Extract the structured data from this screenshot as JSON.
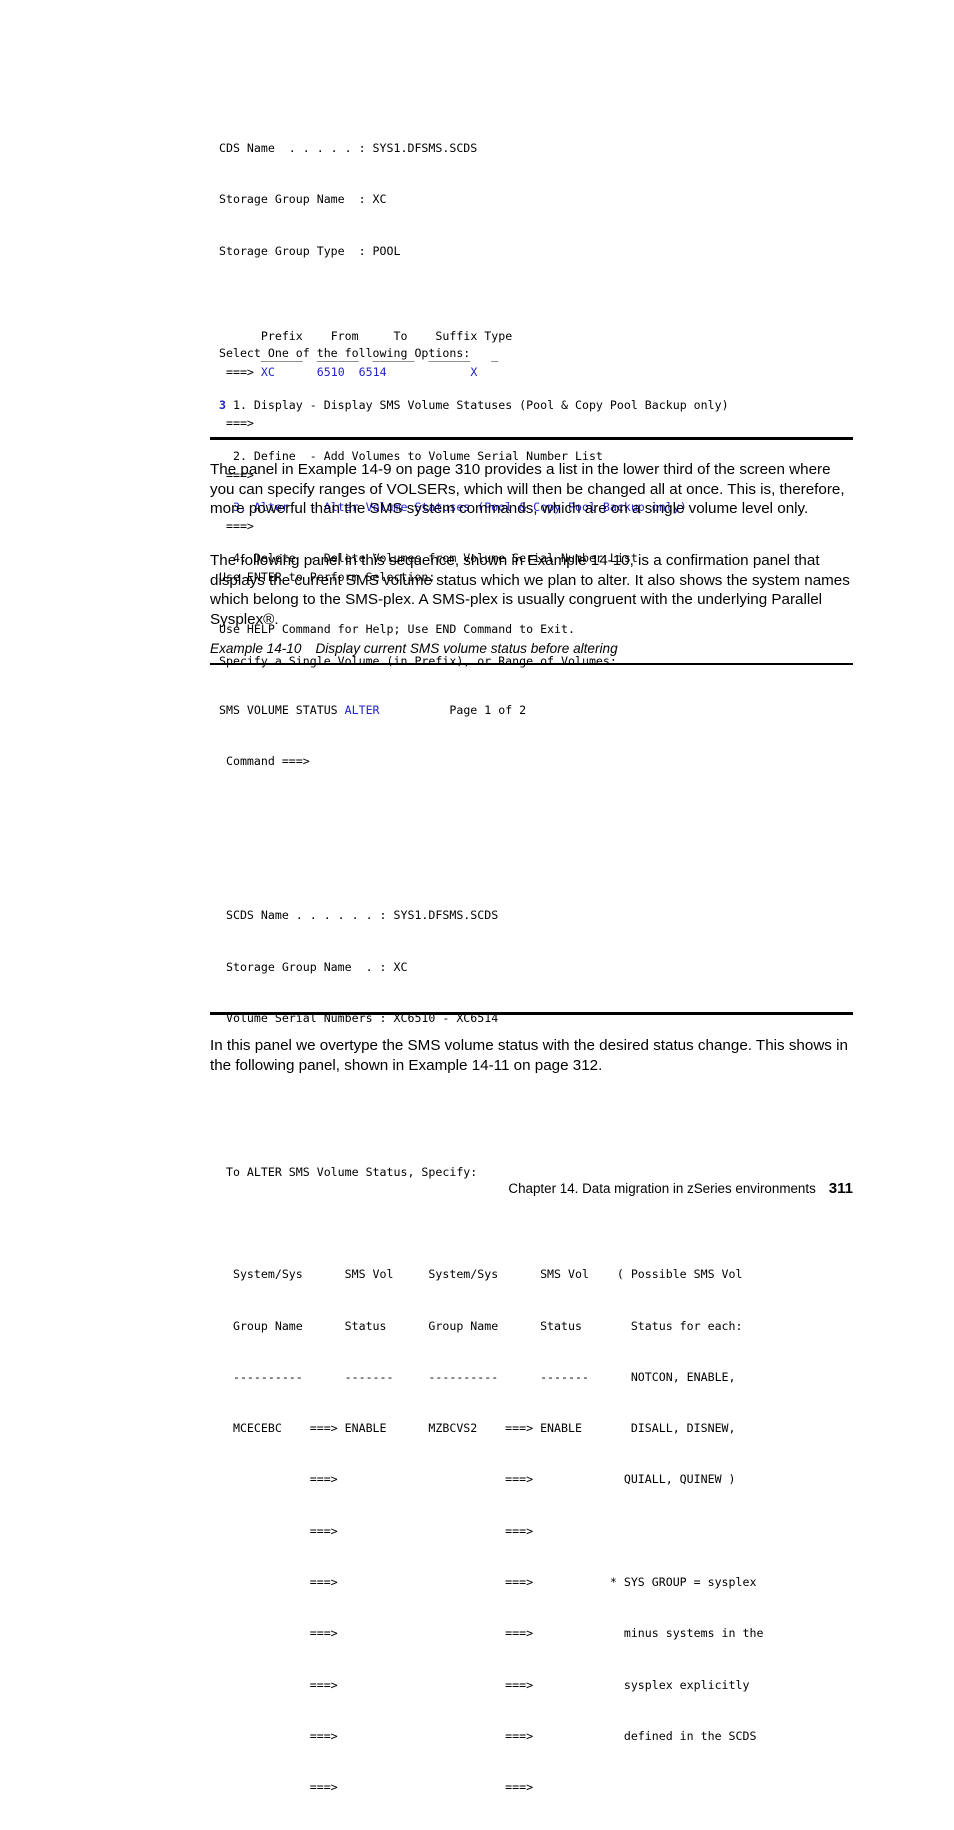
{
  "document": {
    "footer": {
      "chapter_text": "Chapter 14. Data migration in zSeries environments",
      "page_number": "311"
    }
  },
  "panel_1": {
    "name": "sms-volume-status-alter-selection-panel",
    "lines": {
      "cds_name": "CDS Name  . . . . . : SYS1.DFSMS.SCDS",
      "storage_group_name": "Storage Group Name  : XC",
      "storage_group_type": "Storage Group Type  : POOL",
      "select_prompt": "Select One of the following Options:",
      "selection_value": "3",
      "option_1": "1. Display - Display SMS Volume Statuses (Pool & Copy Pool Backup only)",
      "option_2": "2. Define  - Add Volumes to Volume Serial Number List",
      "option_3": "3. Alter   - Alter Volume Statuses (Pool & Copy Pool Backup only)",
      "option_4": "4. Delete  - Delete Volumes from Volume Serial Number List",
      "specify_prompt": "Specify a Single Volume (in Prefix), or Range of Volumes:",
      "column_headers": "     Prefix    To    Suffix Type",
      "col_prefix": "Prefix",
      "col_from": "From",
      "col_to": "To",
      "col_suffix": "Suffix",
      "col_type": "Type",
      "field_underscores": "      ______  ______  ______  ______   _",
      "entry_arrow": "===>",
      "value_prefix": "XC",
      "value_from": "6510",
      "value_to": "6514",
      "value_suffix": "",
      "value_type": "X",
      "entry_row_2": " ===>",
      "entry_row_3": " ===>",
      "entry_row_4": " ===>",
      "use_enter": "Use ENTER to Perform Selection;",
      "use_help": "Use HELP Command for Help; Use END Command to Exit."
    }
  },
  "paragraph_1": "The panel in Example 14-9 on page 310 provides a list in the lower third of the screen where you can specify ranges of VOLSERs, which will then be changed all at once. This is, therefore, more powerful than the SMS system commands, which are on a single volume level only.",
  "paragraph_2": "The following panel in this sequence, shown in Example 14-10, is a confirmation panel that displays the current SMS volume status which we plan to alter. It also shows the system names which belong to the SMS-plex. A SMS-plex is usually congruent with the underlying Parallel Sysplex®.",
  "example_caption": {
    "label": "Example 14-10",
    "title": "Display current SMS volume status before altering"
  },
  "panel_2": {
    "name": "sms-volume-status-alter-confirmation-panel",
    "lines": {
      "title_static": "SMS VOLUME STATUS ",
      "title_highlight": "ALTER",
      "page_indicator": "Page 1 of 2",
      "command_line": " Command ===>",
      "scds_name": " SCDS Name . . . . . . : SYS1.DFSMS.SCDS",
      "storage_group_name": " Storage Group Name  . : XC",
      "volume_serial_numbers": " Volume Serial Numbers : XC6510 - XC6514",
      "alter_prompt": " To ALTER SMS Volume Status, Specify:",
      "header_row_1": "  System/Sys      SMS Vol     System/Sys      SMS Vol    ( Possible SMS Vol",
      "header_row_2": "  Group Name      Status      Group Name      Status       Status for each:",
      "divider_row": "  ----------      -------     ----------      -------      NOTCON, ENABLE,",
      "data_row_1": "  MCECEBC    ===> ENABLE      MZBCVS2    ===> ENABLE       DISALL, DISNEW,",
      "data_row_2": "             ===>                        ===>             QUIALL, QUINEW )",
      "data_row_3": "             ===>                        ===>",
      "data_row_4": "             ===>                        ===>           * SYS GROUP = sysplex",
      "data_row_5": "             ===>                        ===>             minus systems in the",
      "data_row_6": "             ===>                        ===>             sysplex explicitly",
      "data_row_7": "             ===>                        ===>             defined in the SCDS",
      "data_row_8": "             ===>                        ===>"
    }
  },
  "paragraph_3": "In this panel we overtype the SMS volume status with the desired status change. This shows in the following panel, shown in Example 14-11 on page 312."
}
